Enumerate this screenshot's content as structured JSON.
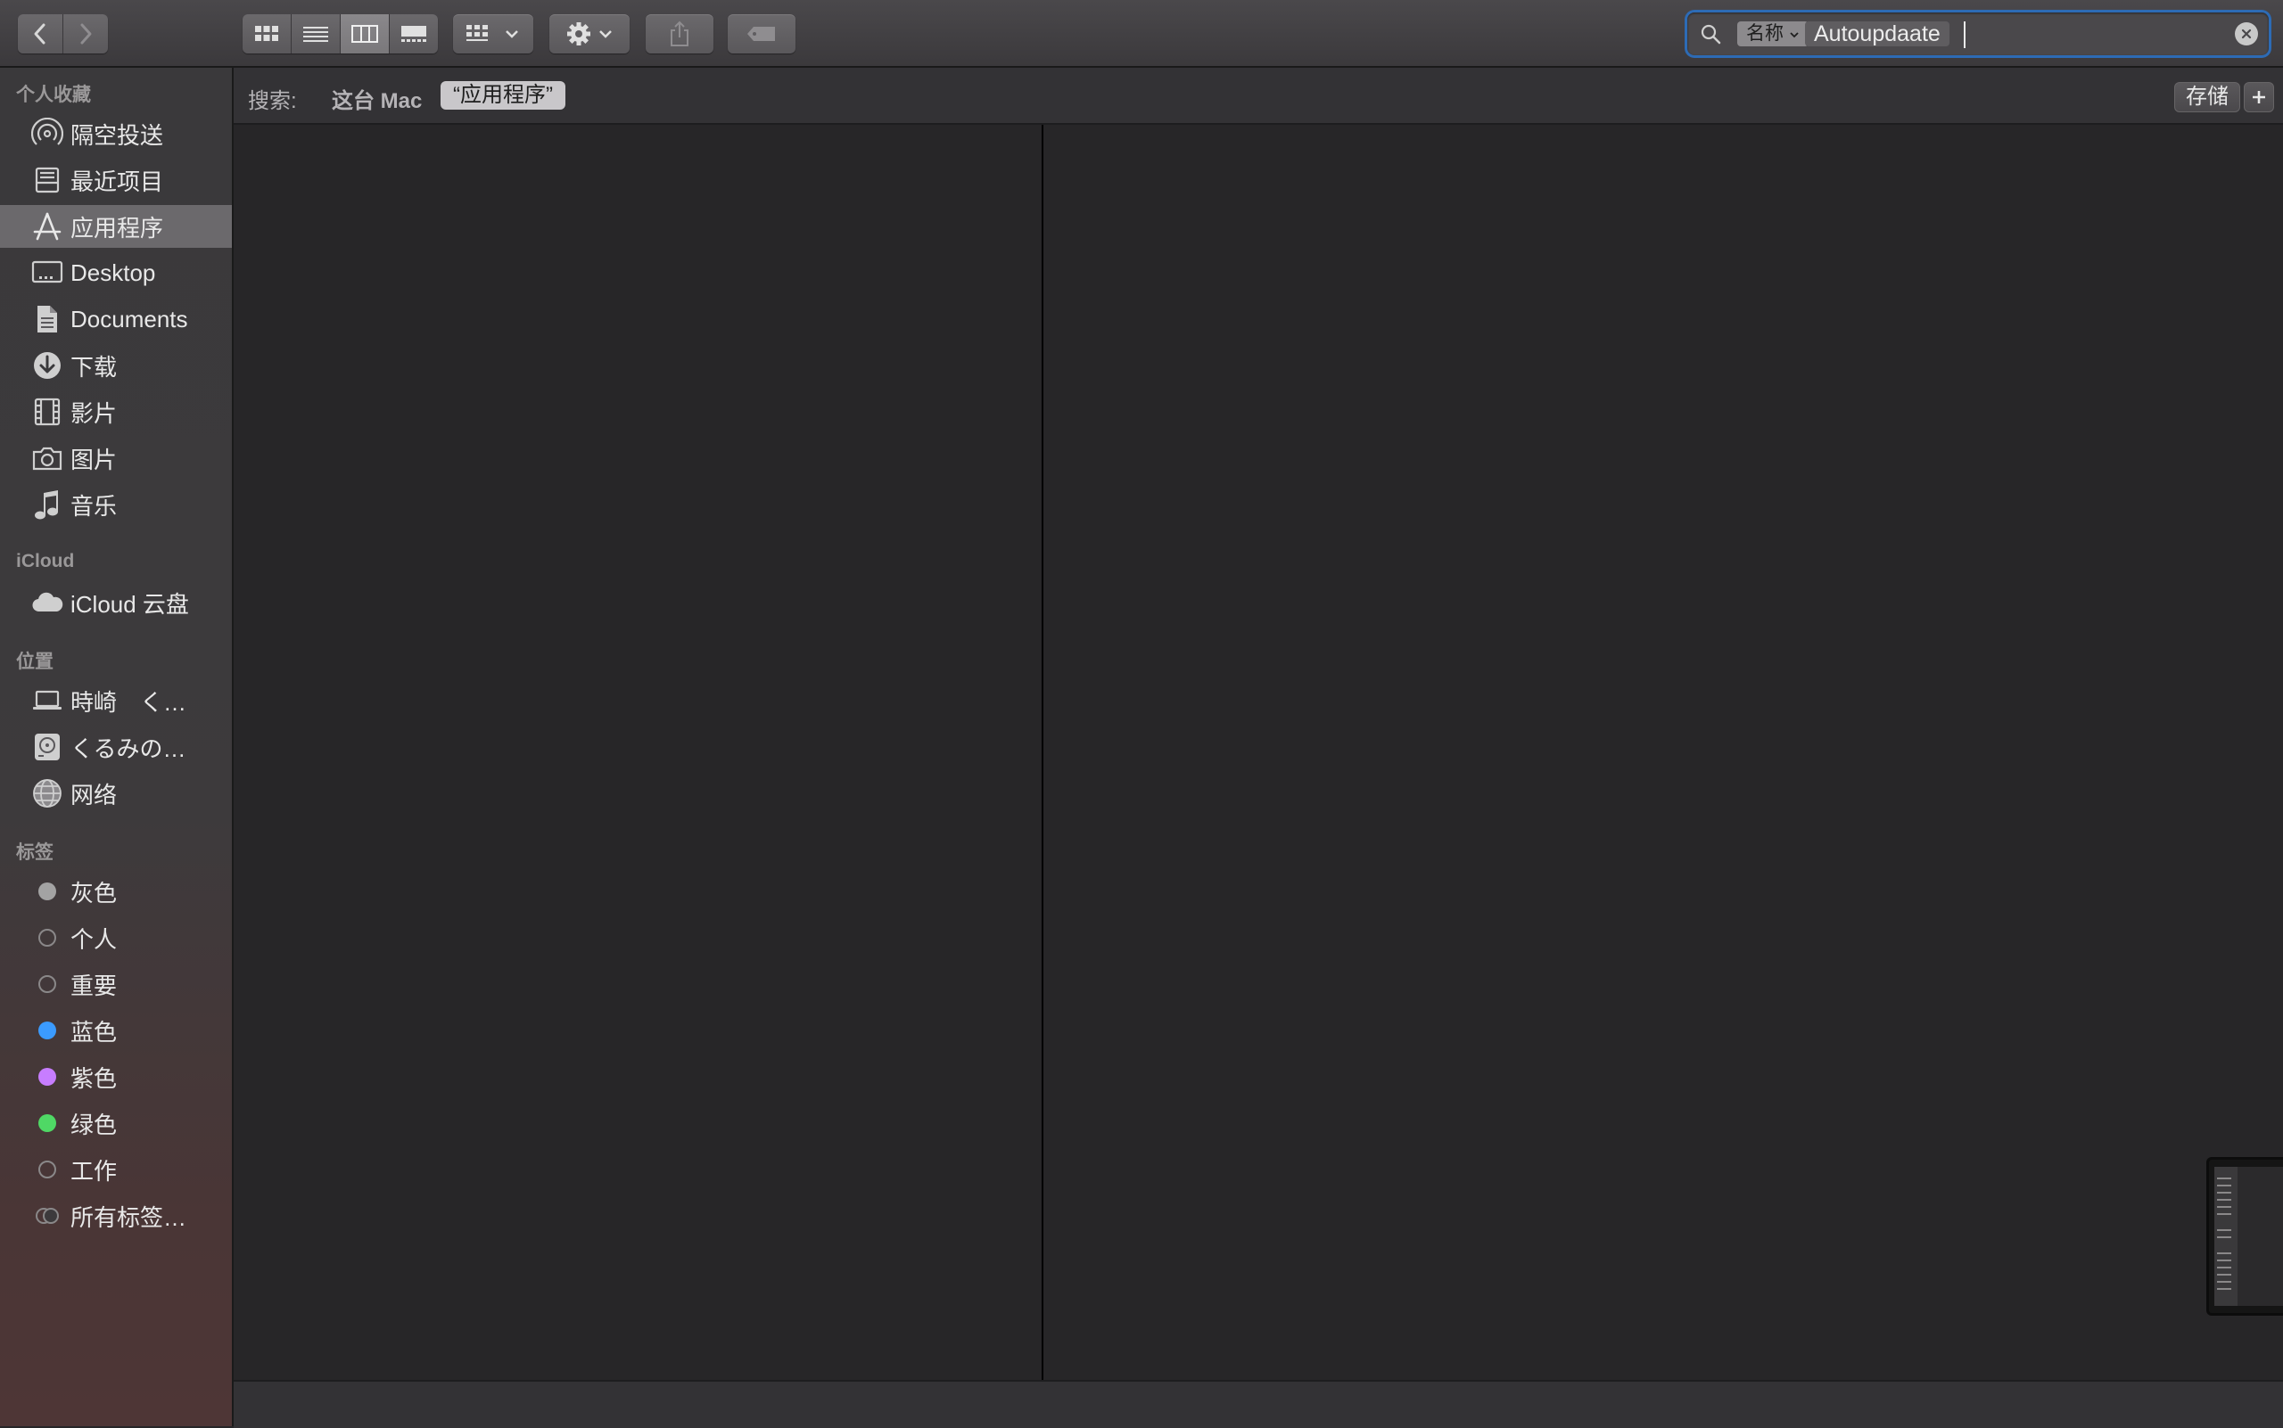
{
  "search": {
    "field_token": "名称",
    "query": "Autoupdaate"
  },
  "scope": {
    "label": "搜索:",
    "this_mac": "这台 Mac",
    "applications": "“应用程序”",
    "save_label": "存储",
    "add_label": "+"
  },
  "sidebar": {
    "favorites": {
      "title": "个人收藏",
      "items": [
        {
          "label": "隔空投送",
          "icon": "airdrop-icon"
        },
        {
          "label": "最近项目",
          "icon": "recents-icon"
        },
        {
          "label": "应用程序",
          "icon": "applications-icon",
          "active": true
        },
        {
          "label": "Desktop",
          "icon": "desktop-icon"
        },
        {
          "label": "Documents",
          "icon": "documents-icon"
        },
        {
          "label": "下载",
          "icon": "downloads-icon"
        },
        {
          "label": "影片",
          "icon": "movies-icon"
        },
        {
          "label": "图片",
          "icon": "pictures-icon"
        },
        {
          "label": "音乐",
          "icon": "music-icon"
        }
      ]
    },
    "icloud": {
      "title": "iCloud",
      "items": [
        {
          "label": "iCloud 云盘",
          "icon": "cloud-icon"
        }
      ]
    },
    "locations": {
      "title": "位置",
      "items": [
        {
          "label": "時崎　く…",
          "icon": "laptop-icon"
        },
        {
          "label": "くるみの…",
          "icon": "disk-icon"
        },
        {
          "label": "网络",
          "icon": "network-icon"
        }
      ]
    },
    "tags": {
      "title": "标签",
      "items": [
        {
          "label": "灰色",
          "color": "#a3a3a3"
        },
        {
          "label": "个人",
          "color": ""
        },
        {
          "label": "重要",
          "color": ""
        },
        {
          "label": "蓝色",
          "color": "#3b9bff"
        },
        {
          "label": "紫色",
          "color": "#c77dff"
        },
        {
          "label": "绿色",
          "color": "#4fd865"
        },
        {
          "label": "工作",
          "color": ""
        },
        {
          "label": "所有标签…",
          "color": "all"
        }
      ]
    }
  }
}
